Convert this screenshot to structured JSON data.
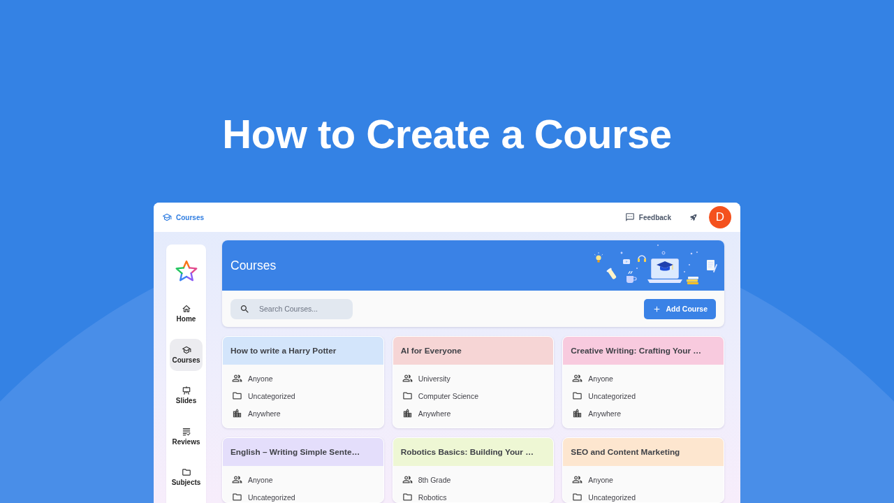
{
  "heading": "How to Create a Course",
  "app": {
    "top_bar": {
      "breadcrumb": "Courses",
      "feedback": "Feedback",
      "avatar": "D"
    },
    "sidebar": {
      "items": [
        {
          "label": "Home",
          "selected": false
        },
        {
          "label": "Courses",
          "selected": true
        },
        {
          "label": "Slides",
          "selected": false
        },
        {
          "label": "Reviews",
          "selected": false
        },
        {
          "label": "Subjects",
          "selected": false
        }
      ]
    },
    "header": {
      "title": "Courses",
      "search": {
        "placeholder": "Search Courses..."
      },
      "add_button": "Add Course"
    },
    "courses": [
      {
        "title": "How to write a Harry Potter",
        "color": "#d3e5fb",
        "audience": "Anyone",
        "subject": "Uncategorized",
        "location": "Anywhere"
      },
      {
        "title": "AI for Everyone",
        "color": "#f6d5d5",
        "audience": "University",
        "subject": "Computer Science",
        "location": "Anywhere"
      },
      {
        "title": "Creative Writing: Crafting Your …",
        "color": "#f8cade",
        "audience": "Anyone",
        "subject": "Uncategorized",
        "location": "Anywhere"
      },
      {
        "title": "English – Writing Simple Sente…",
        "color": "#e4defb",
        "audience": "Anyone",
        "subject": "Uncategorized"
      },
      {
        "title": "Robotics Basics: Building Your …",
        "color": "#eef7d4",
        "audience": "8th Grade",
        "subject": "Robotics"
      },
      {
        "title": "SEO and Content Marketing",
        "color": "#fde6cf",
        "audience": "Anyone",
        "subject": "Uncategorized"
      }
    ]
  }
}
